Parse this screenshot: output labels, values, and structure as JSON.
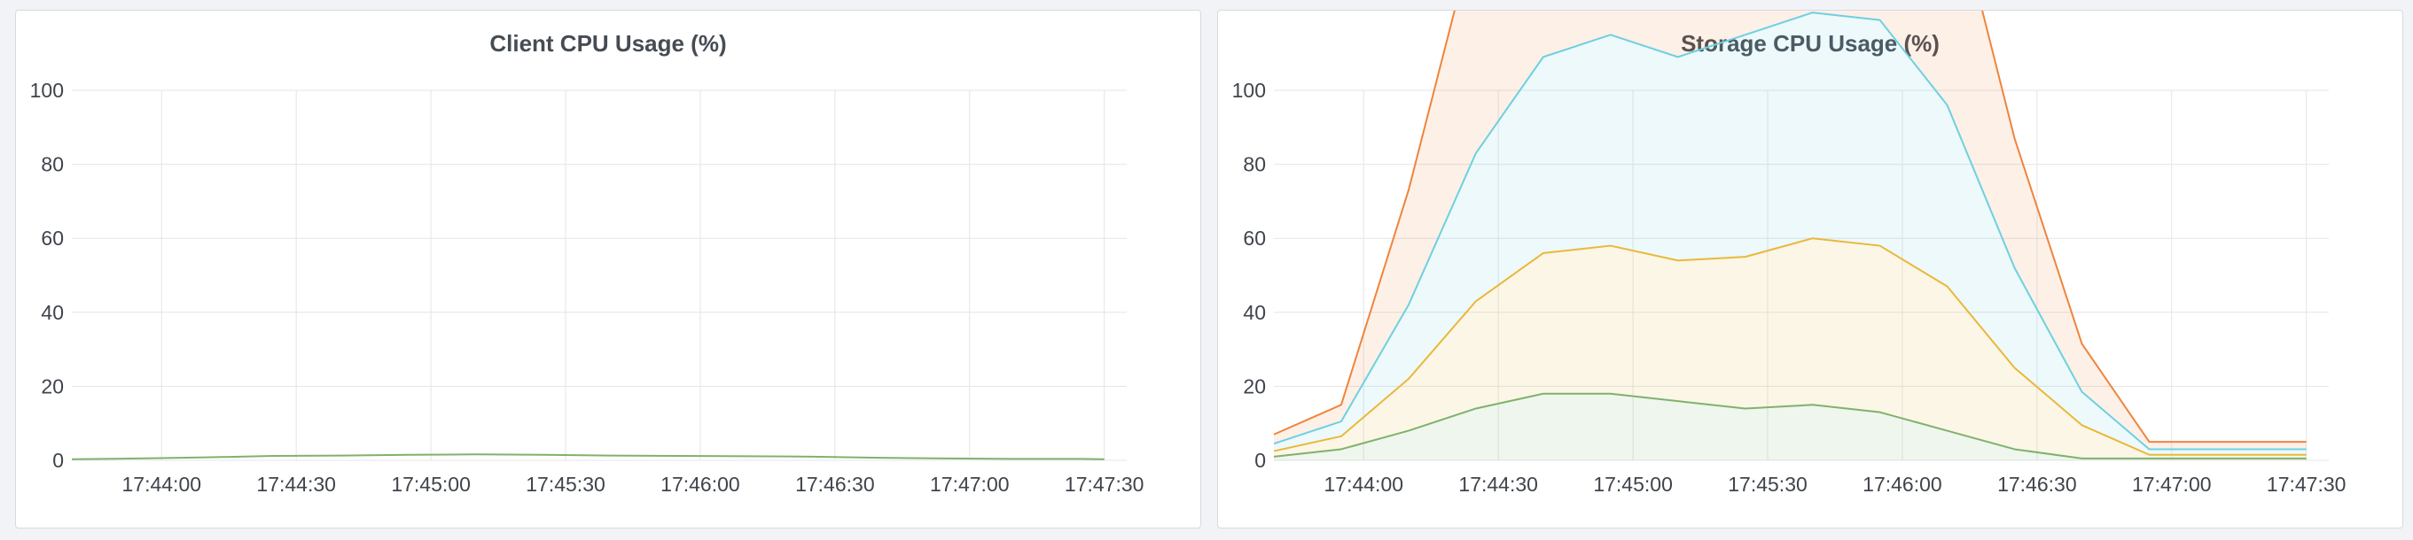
{
  "panels": [
    {
      "title": "Client CPU Usage (%)",
      "chart_data": {
        "type": "line",
        "title": "Client CPU Usage (%)",
        "xlabel": "",
        "ylabel": "",
        "ylim": [
          0,
          100
        ],
        "yticks": [
          0,
          20,
          40,
          60,
          80,
          100
        ],
        "xlim": [
          "17:43:40",
          "17:47:35"
        ],
        "xticks": [
          "17:44:00",
          "17:44:30",
          "17:45:00",
          "17:45:30",
          "17:46:00",
          "17:46:30",
          "17:47:00",
          "17:47:30"
        ],
        "grid": true,
        "stacked": false,
        "x": [
          "17:43:40",
          "17:43:55",
          "17:44:10",
          "17:44:25",
          "17:44:40",
          "17:44:55",
          "17:45:10",
          "17:45:25",
          "17:45:40",
          "17:45:55",
          "17:46:10",
          "17:46:25",
          "17:46:40",
          "17:46:55",
          "17:47:10",
          "17:47:25",
          "17:47:30"
        ],
        "series": [
          {
            "color": "#7eb26d",
            "fill": false,
            "values": [
              0.3,
              0.5,
              0.8,
              1.2,
              1.3,
              1.5,
              1.6,
              1.5,
              1.3,
              1.2,
              1.1,
              1.0,
              0.7,
              0.5,
              0.4,
              0.4,
              0.3
            ]
          }
        ]
      }
    },
    {
      "title": "Storage CPU Usage (%)",
      "chart_data": {
        "type": "area",
        "title": "Storage CPU Usage (%)",
        "xlabel": "",
        "ylabel": "",
        "ylim": [
          0,
          100
        ],
        "yticks": [
          0,
          20,
          40,
          60,
          80,
          100
        ],
        "xlim": [
          "17:43:40",
          "17:47:35"
        ],
        "xticks": [
          "17:44:00",
          "17:44:30",
          "17:45:00",
          "17:45:30",
          "17:46:00",
          "17:46:30",
          "17:47:00",
          "17:47:30"
        ],
        "grid": true,
        "stacked": true,
        "x": [
          "17:43:40",
          "17:43:55",
          "17:44:10",
          "17:44:25",
          "17:44:40",
          "17:44:55",
          "17:45:10",
          "17:45:25",
          "17:45:40",
          "17:45:55",
          "17:46:10",
          "17:46:25",
          "17:46:40",
          "17:46:55",
          "17:47:10",
          "17:47:25",
          "17:47:30"
        ],
        "series": [
          {
            "color": "#7eb26d",
            "fill": true,
            "values": [
              1,
              3,
              8,
              14,
              18,
              18,
              16,
              14,
              15,
              13,
              8,
              3,
              0.5,
              0.5,
              0.5,
              0.5,
              0.5
            ]
          },
          {
            "color": "#eab839",
            "fill": true,
            "values": [
              1.5,
              3.5,
              14,
              29,
              38,
              40,
              38,
              41,
              45,
              45,
              39,
              22,
              9,
              1,
              1,
              1,
              1
            ]
          },
          {
            "color": "#6ed0e0",
            "fill": true,
            "values": [
              2,
              4,
              20,
              40,
              53,
              57,
              55,
              60,
              61,
              61,
              49,
              27,
              9,
              1.5,
              1.5,
              1.5,
              1.5
            ]
          },
          {
            "color": "#ef843c",
            "fill": true,
            "values": [
              2.5,
              4.5,
              31,
              61,
              82,
              87,
              84,
              87,
              84,
              78,
              63,
              35,
              13,
              2,
              2,
              2,
              2
            ]
          }
        ]
      }
    }
  ]
}
